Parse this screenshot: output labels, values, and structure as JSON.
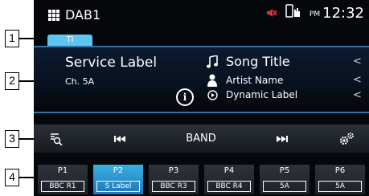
{
  "header": {
    "source": "DAB1",
    "ampm": "PM",
    "time": "12:32",
    "icons": [
      "grid-menu-icon",
      "mute-icon",
      "phone-battery-icon"
    ]
  },
  "ti_badge": "TI",
  "info": {
    "service_label": "Service Label",
    "channel": "Ch. 5A",
    "song_title": "Song Title",
    "artist_name": "Artist Name",
    "dynamic_label": "Dynamic Label",
    "info_button": "i",
    "chevron": "<"
  },
  "controls": {
    "search_icon": "search-list-icon",
    "prev_icon": "seek-back-icon",
    "band_label": "BAND",
    "next_icon": "seek-forward-icon",
    "settings_icon": "settings-gears-icon"
  },
  "presets": [
    {
      "num": "P1",
      "label": "BBC R1",
      "active": false
    },
    {
      "num": "P2",
      "label": "S Label",
      "active": true
    },
    {
      "num": "P3",
      "label": "BBC R3",
      "active": false
    },
    {
      "num": "P4",
      "label": "BBC R4",
      "active": false
    },
    {
      "num": "P5",
      "label": "5A",
      "active": false
    },
    {
      "num": "P6",
      "label": "5A",
      "active": false
    }
  ],
  "callouts": [
    "1",
    "2",
    "3",
    "4"
  ],
  "colors": {
    "accent": "#5ec6ee",
    "active_preset": "#2a8fd0",
    "panel_border": "#2a72a8",
    "mute_icon": "#e0303a"
  }
}
